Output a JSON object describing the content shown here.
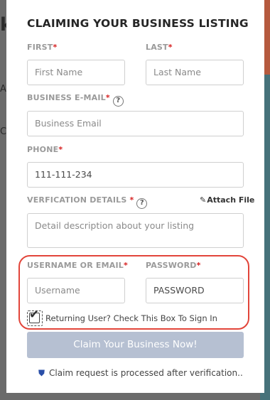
{
  "modal": {
    "title": "CLAIMING YOUR BUSINESS LISTING",
    "first": {
      "label": "FIRST",
      "required": "*",
      "placeholder": "First Name"
    },
    "last": {
      "label": "LAST",
      "required": "*",
      "placeholder": "Last Name"
    },
    "email": {
      "label": "BUSINESS E-MAIL",
      "required": "*",
      "help": "?",
      "placeholder": "Business Email"
    },
    "phone": {
      "label": "PHONE",
      "required": "*",
      "value": "111-111-234"
    },
    "verification": {
      "label": "VERFICATION DETAILS",
      "required": "*",
      "help": "?",
      "placeholder": "Detail description about your listing"
    },
    "attach_label": "Attach File",
    "username": {
      "label": "USERNAME OR EMAIL",
      "required": "*",
      "placeholder": "Username"
    },
    "password": {
      "label": "PASSWORD",
      "required": "*",
      "placeholder": "PASSWORD"
    },
    "returning_user_label": "Returning User? Check This Box To Sign In",
    "returning_user_checked": true,
    "submit_label": "Claim Your Business Now!",
    "note": "Claim request is processed after verification.."
  },
  "background": {
    "glyph_top": "k",
    "glyph_mid": "A",
    "glyph_low": "C"
  },
  "colors": {
    "required": "#d62020",
    "highlight": "#e2453a",
    "submit_bg": "#b6c0d2",
    "shield": "#2a4fa8"
  },
  "icons": {
    "help": "question-circle-icon",
    "attach": "paperclip-icon",
    "check": "checkmark-icon",
    "note": "shield-icon"
  }
}
